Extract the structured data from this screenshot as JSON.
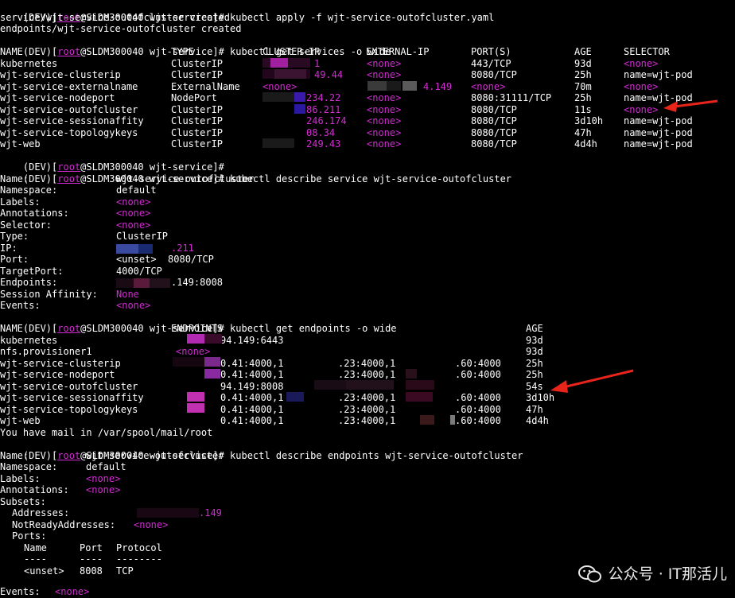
{
  "prompt": {
    "open": "(DEV)[",
    "user": "root",
    "host_path": "@SLDM300040 wjt-service]# "
  },
  "block1": {
    "cmd": "kubectl apply -f wjt-service-outofcluster.yaml",
    "out1": "service/wjt-service-outofcluster created",
    "out2": "endpoints/wjt-service-outofcluster created",
    "cmd2": "kubectl get services -o wide"
  },
  "services_table": {
    "headers": [
      "NAME",
      "TYPE",
      "CLUSTER-IP",
      "EXTERNAL-IP",
      "PORT(S)",
      "AGE",
      "SELECTOR"
    ],
    "rows": [
      {
        "name": "kubernetes",
        "type": "ClusterIP",
        "cip": "1",
        "eip": "<none>",
        "port": "443/TCP",
        "age": "93d",
        "sel": "<none>"
      },
      {
        "name": "wjt-service-clusterip",
        "type": "ClusterIP",
        "cip": "49.44",
        "eip": "<none>",
        "port": "8080/TCP",
        "age": "25h",
        "sel": "name=wjt-pod"
      },
      {
        "name": "wjt-service-externalname",
        "type": "ExternalName",
        "cip": "<none>",
        "eip": "4.149",
        "port": "<none>",
        "age": "70m",
        "sel": "<none>"
      },
      {
        "name": "wjt-service-nodeport",
        "type": "NodePort",
        "cip": "234.22",
        "eip": "<none>",
        "port": "8080:31111/TCP",
        "age": "25h",
        "sel": "name=wjt-pod"
      },
      {
        "name": "wjt-service-outofcluster",
        "type": "ClusterIP",
        "cip": "86.211",
        "eip": "<none>",
        "port": "8080/TCP",
        "age": "11s",
        "sel": "<none>"
      },
      {
        "name": "wjt-service-sessionaffity",
        "type": "ClusterIP",
        "cip": "246.174",
        "eip": "<none>",
        "port": "8080/TCP",
        "age": "3d10h",
        "sel": "name=wjt-pod"
      },
      {
        "name": "wjt-service-topologykeys",
        "type": "ClusterIP",
        "cip": "08.34",
        "eip": "<none>",
        "port": "8080/TCP",
        "age": "47h",
        "sel": "name=wjt-pod"
      },
      {
        "name": "wjt-web",
        "type": "ClusterIP",
        "cip": "249.43",
        "eip": "<none>",
        "port": "8080/TCP",
        "age": "4d4h",
        "sel": "name=wjt-pod"
      }
    ]
  },
  "describe_service": {
    "cmd": "kubectl describe service wjt-service-outofcluster",
    "fields": [
      {
        "k": "Name:",
        "v": "wjt-service-outofcluster"
      },
      {
        "k": "Namespace:",
        "v": "default"
      },
      {
        "k": "Labels:",
        "v": "<none>"
      },
      {
        "k": "Annotations:",
        "v": "<none>"
      },
      {
        "k": "Selector:",
        "v": "<none>"
      },
      {
        "k": "Type:",
        "v": "ClusterIP"
      },
      {
        "k": "IP:",
        "v": ".211"
      },
      {
        "k": "Port:",
        "v": "<unset>  8080/TCP"
      },
      {
        "k": "TargetPort:",
        "v": "4000/TCP"
      },
      {
        "k": "Endpoints:",
        "v": ".149:8008"
      },
      {
        "k": "Session Affinity:",
        "v": "None"
      },
      {
        "k": "Events:",
        "v": "<none>"
      }
    ]
  },
  "endpoints_table": {
    "cmd": "kubectl get endpoints -o wide",
    "headers": [
      "NAME",
      "ENDPOINTS",
      "AGE"
    ],
    "rows": [
      {
        "name": "kubernetes",
        "ep": "94.149:6443",
        "age": "93d"
      },
      {
        "name": "nfs.provisioner1",
        "ep": "<none>",
        "age": "93d"
      },
      {
        "name": "wjt-service-clusterip",
        "ep": "0.41:4000,1",
        "ep2": ".23:4000,1",
        "ep3": ".60:4000",
        "age": "25h"
      },
      {
        "name": "wjt-service-nodeport",
        "ep": "0.41:4000,1",
        "ep2": ".23:4000,1",
        "ep3": ".60:4000",
        "age": "25h"
      },
      {
        "name": "wjt-service-outofcluster",
        "ep": "94.149:8008",
        "age": "54s"
      },
      {
        "name": "wjt-service-sessionaffity",
        "ep": "0.41:4000,1",
        "ep2": ".23:4000,1",
        "ep3": ".60:4000",
        "age": "3d10h"
      },
      {
        "name": "wjt-service-topologykeys",
        "ep": "0.41:4000,1",
        "ep2": ".23:4000,1",
        "ep3": ".60:4000",
        "age": "47h"
      },
      {
        "name": "wjt-web",
        "ep": "0.41:4000,1",
        "ep2": ".23:4000,1",
        "ep3": ".60:4000",
        "age": "4d4h"
      }
    ],
    "mail": "You have mail in /var/spool/mail/root"
  },
  "describe_endpoints": {
    "cmd": "kubectl describe endpoints wjt-service-outofcluster",
    "name_k": "Name:",
    "name_v": "wjt-service-outofcluster",
    "ns_k": "Namespace:",
    "ns_v": "default",
    "labels_k": "Labels:",
    "labels_v": "<none>",
    "ann_k": "Annotations:",
    "ann_v": "<none>",
    "subsets": "Subsets:",
    "addr_k": "Addresses:",
    "addr_v": ".149",
    "nra_k": "NotReadyAddresses:",
    "nra_v": "<none>",
    "ports": "Ports:",
    "ph_name": "Name",
    "ph_port": "Port",
    "ph_proto": "Protocol",
    "dash1": "----",
    "dash2": "----",
    "dash3": "--------",
    "pv_name": "<unset>",
    "pv_port": "8008",
    "pv_proto": "TCP",
    "events_k": "Events:",
    "events_v": "<none>"
  },
  "watermark": {
    "text": "公众号 · IT那活儿",
    "icon": "wechat-icon"
  },
  "colors": {
    "background": "#000000",
    "text": "#ffffff",
    "accent": "#d22bd2",
    "arrow": "#e8241b"
  }
}
